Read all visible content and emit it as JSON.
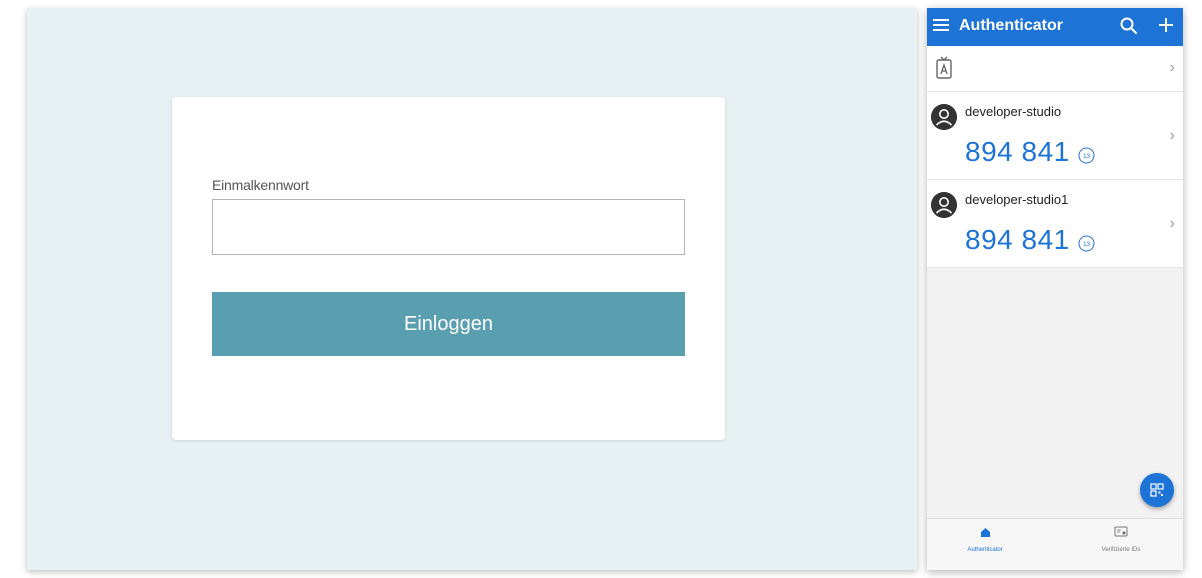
{
  "login": {
    "otp_label": "Einmalkennwort",
    "otp_value": "",
    "login_button": "Einloggen"
  },
  "authenticator": {
    "title": "Authenticator",
    "accounts": [
      {
        "name": "developer-studio",
        "code": "894 841",
        "seconds_left": "13"
      },
      {
        "name": "developer-studio1",
        "code": "894 841",
        "seconds_left": "13"
      }
    ],
    "nav": {
      "authenticator_label": "Authenticator",
      "verified_ids_label": "Verifizierte IDs"
    }
  },
  "colors": {
    "app_blue": "#1e74d6",
    "button_teal": "#5a9fb0",
    "panel_bg": "#e7f1f3"
  }
}
